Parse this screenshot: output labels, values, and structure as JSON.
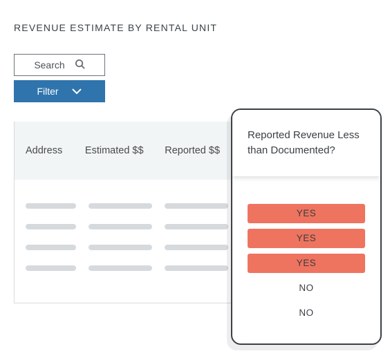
{
  "title": "REVENUE ESTIMATE BY RENTAL UNIT",
  "controls": {
    "search_label": "Search",
    "filter_label": "Filter"
  },
  "table": {
    "columns": {
      "address": "Address",
      "estimated": "Estimated $$",
      "reported": "Reported $$"
    }
  },
  "popup": {
    "heading": "Reported Revenue Less than Documented?",
    "rows": [
      {
        "value": "YES",
        "flag": "yes"
      },
      {
        "value": "YES",
        "flag": "yes"
      },
      {
        "value": "YES",
        "flag": "yes"
      },
      {
        "value": "NO",
        "flag": "no"
      },
      {
        "value": "NO",
        "flag": "no"
      }
    ]
  },
  "colors": {
    "accent": "#2f74ac",
    "alert": "#ee7460"
  }
}
